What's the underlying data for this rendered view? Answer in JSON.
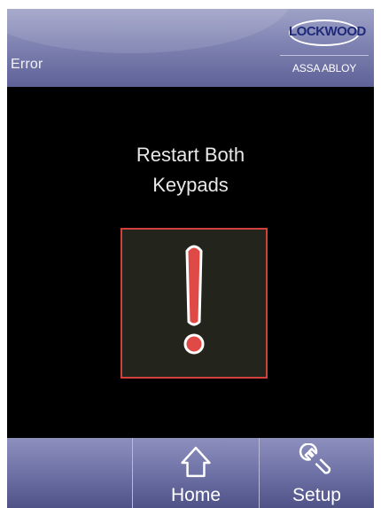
{
  "header": {
    "title": "Error",
    "logo_text": "LOCKWOOD",
    "logo_subtext": "ASSA ABLOY"
  },
  "main": {
    "message_line1": "Restart Both",
    "message_line2": "Keypads",
    "alert_icon": "exclamation-icon"
  },
  "nav": {
    "buttons": [
      {
        "label": "",
        "icon": ""
      },
      {
        "label": "Home",
        "icon": "home-icon"
      },
      {
        "label": "Setup",
        "icon": "wrench-icon"
      }
    ]
  },
  "colors": {
    "header_bg": "#7f83b2",
    "screen_bg": "#000000",
    "alert_red": "#d0413e",
    "alert_box_bg": "#23241c",
    "logo_text": "#1f2a7a"
  }
}
